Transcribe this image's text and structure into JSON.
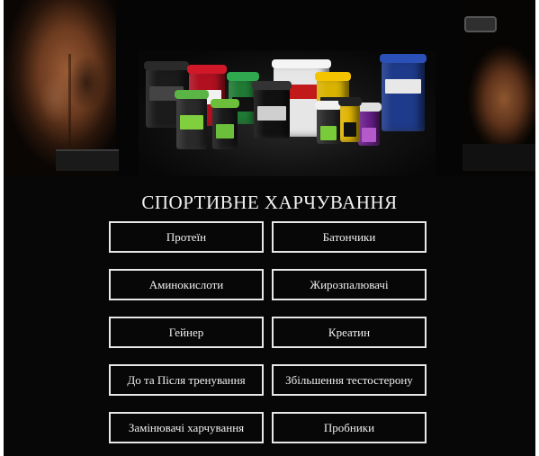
{
  "banner": {
    "image_name": "sport-nutrition-products-banner",
    "tub_colors": [
      "#1b1b1b",
      "#c1121f",
      "#2fa84f",
      "#e8e8e8",
      "#1e3a8a",
      "#222222",
      "#f5c400",
      "#7a1fa2"
    ]
  },
  "heading": {
    "title": "СПОРТИВНЕ ХАРЧУВАННЯ"
  },
  "categories": [
    {
      "label": "Протеїн"
    },
    {
      "label": "Батончики"
    },
    {
      "label": "Аминокислоти"
    },
    {
      "label": "Жирозпалювачі"
    },
    {
      "label": "Гейнер"
    },
    {
      "label": "Креатин"
    },
    {
      "label": "До та Після тренування"
    },
    {
      "label": "Збільшення тестостерону"
    },
    {
      "label": "Замінювачі харчування"
    },
    {
      "label": "Пробники"
    }
  ]
}
